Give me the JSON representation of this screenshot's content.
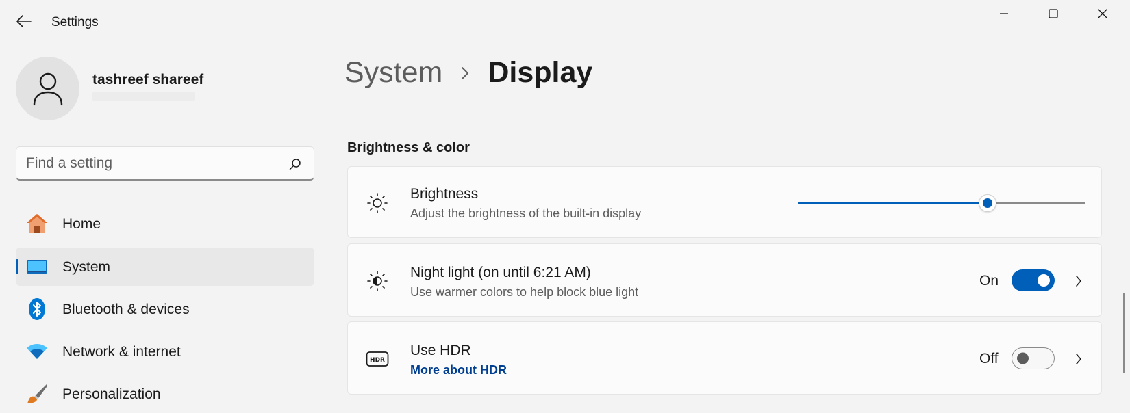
{
  "window": {
    "title": "Settings",
    "controls": {
      "minimize": "minimize-icon",
      "maximize": "maximize-icon",
      "close": "close-icon"
    }
  },
  "profile": {
    "name": "tashreef shareef"
  },
  "search": {
    "placeholder": "Find a setting"
  },
  "sidebar": {
    "items": [
      {
        "label": "Home",
        "icon": "home-icon"
      },
      {
        "label": "System",
        "icon": "system-icon",
        "selected": true
      },
      {
        "label": "Bluetooth & devices",
        "icon": "bluetooth-icon"
      },
      {
        "label": "Network & internet",
        "icon": "wifi-icon"
      },
      {
        "label": "Personalization",
        "icon": "brush-icon"
      }
    ]
  },
  "breadcrumb": {
    "parent": "System",
    "current": "Display"
  },
  "section": {
    "title": "Brightness & color"
  },
  "cards": {
    "brightness": {
      "title": "Brightness",
      "subtitle": "Adjust the brightness of the built-in display",
      "icon": "sun-icon",
      "value": 0.66
    },
    "night_light": {
      "title": "Night light (on until 6:21 AM)",
      "subtitle": "Use warmer colors to help block blue light",
      "icon": "night-light-icon",
      "state_label": "On",
      "on": true
    },
    "hdr": {
      "title": "Use HDR",
      "link": "More about HDR",
      "icon": "hdr-icon",
      "state_label": "Off",
      "on": false
    }
  },
  "colors": {
    "accent": "#005fb8",
    "link": "#003e92",
    "background": "#f3f3f3"
  }
}
